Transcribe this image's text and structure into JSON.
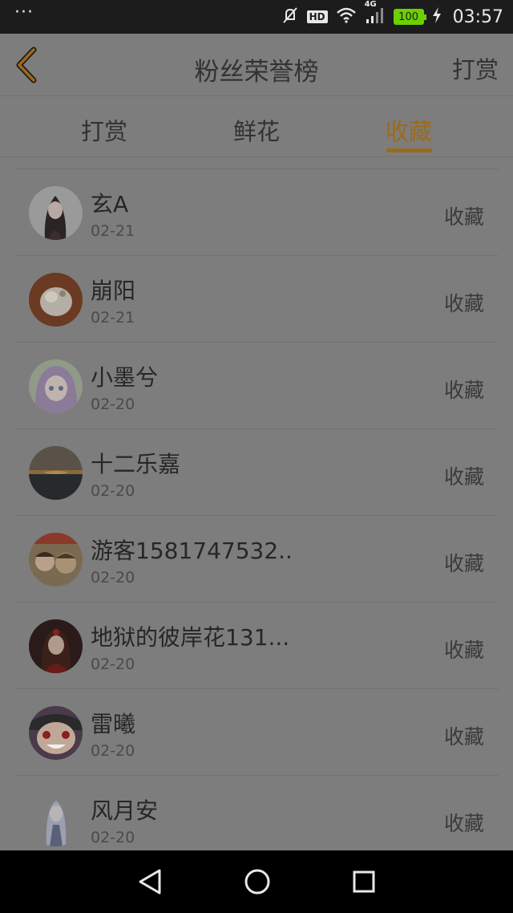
{
  "status_bar": {
    "dots": "···",
    "hd": "HD",
    "network": "4G",
    "battery": "100",
    "time": "03:57"
  },
  "header": {
    "title": "粉丝荣誉榜",
    "action": "打赏"
  },
  "tabs": [
    {
      "label": "打赏",
      "active": false
    },
    {
      "label": "鲜花",
      "active": false
    },
    {
      "label": "收藏",
      "active": true
    }
  ],
  "accent_color": "#9b6a1c",
  "fans": [
    {
      "name": "玄A",
      "date": "02-21",
      "action": "收藏"
    },
    {
      "name": "崩阳",
      "date": "02-21",
      "action": "收藏"
    },
    {
      "name": "小墨兮",
      "date": "02-20",
      "action": "收藏"
    },
    {
      "name": "十二乐嘉",
      "date": "02-20",
      "action": "收藏"
    },
    {
      "name": "游客1581747532...",
      "date": "02-20",
      "action": "收藏"
    },
    {
      "name": "地狱的彼岸花131...",
      "date": "02-20",
      "action": "收藏"
    },
    {
      "name": "雷曦",
      "date": "02-20",
      "action": "收藏"
    },
    {
      "name": "风月安",
      "date": "02-20",
      "action": "收藏"
    }
  ]
}
